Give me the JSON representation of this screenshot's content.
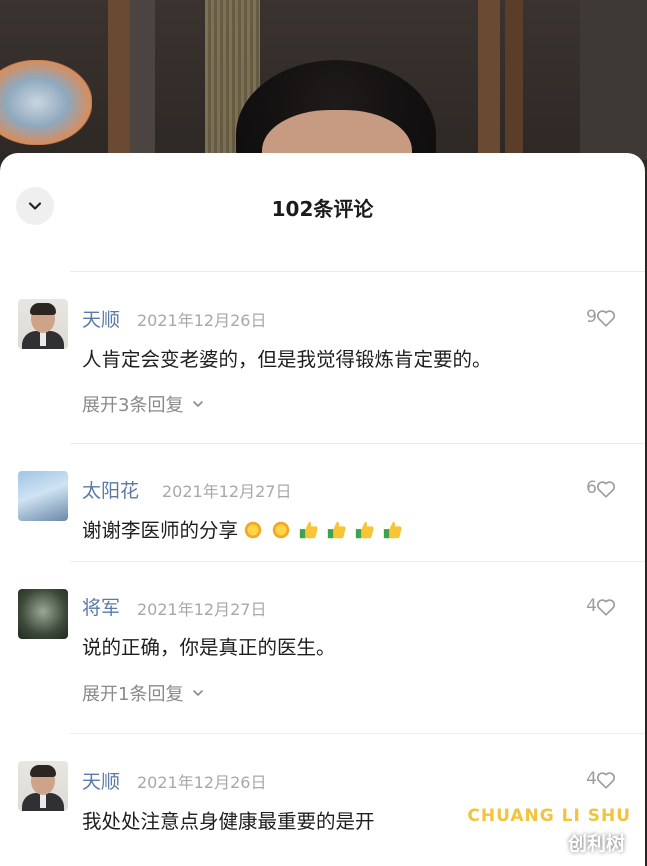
{
  "header": {
    "title": "102条评论"
  },
  "comments": [
    {
      "name": "天顺",
      "date": "2021年12月26日",
      "likes": "9",
      "text": "人肯定会变老婆的，但是我觉得锻炼肯定要的。",
      "replies": "展开3条回复",
      "avatar": "man-portrait"
    },
    {
      "name": "太阳花",
      "date": "2021年12月27日",
      "likes": "6",
      "text": "谢谢李医师的分享",
      "emojis": [
        "sun",
        "sun",
        "thumbs-up",
        "thumbs-up",
        "thumbs-up",
        "thumbs-up"
      ],
      "avatar": "sky-photo"
    },
    {
      "name": "将军",
      "date": "2021年12月27日",
      "likes": "4",
      "text": "说的正确，你是真正的医生。",
      "replies": "展开1条回复",
      "avatar": "bird-photo"
    },
    {
      "name": "天顺",
      "date": "2021年12月26日",
      "likes": "4",
      "text": "我处处注意点身健康最重要的是开",
      "avatar": "man-portrait"
    }
  ],
  "watermark": {
    "brand": "CHUANG LI SHU",
    "text": "创利树"
  },
  "colors": {
    "name": "#5b7aa6",
    "date": "#a8a8a8",
    "sheet": "#ffffff",
    "watermark": "#f0c43c"
  }
}
